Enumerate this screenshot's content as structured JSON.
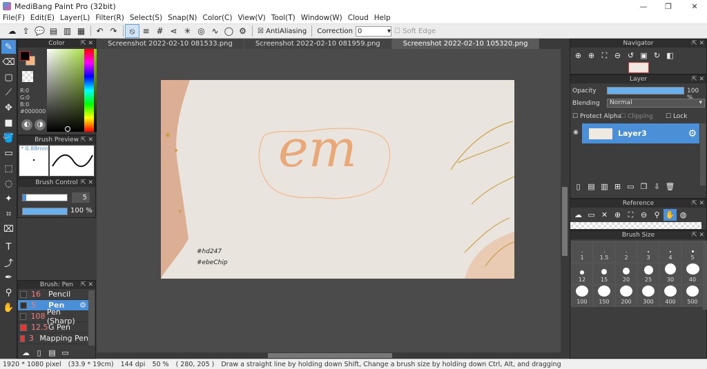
{
  "app": {
    "title": "MediBang Paint Pro (32bit)"
  },
  "menu": [
    "File(F)",
    "Edit(E)",
    "Layer(L)",
    "Filter(R)",
    "Select(S)",
    "Snap(N)",
    "Color(C)",
    "View(V)",
    "Tool(T)",
    "Window(W)",
    "Cloud",
    "Help"
  ],
  "toolbar": {
    "antialias_label": "AntiAliasing",
    "correction_label": "Correction",
    "correction_value": "0",
    "soft_edge_label": "Soft Edge"
  },
  "color_panel": {
    "title": "Color",
    "r": "R:0",
    "g": "G:0",
    "b": "B:0",
    "hex": "#000000",
    "primary_color": "#000000",
    "secondary_color": "#f0b880"
  },
  "brush_preview": {
    "title": "Brush Preview",
    "size": "* 0.88mm"
  },
  "brush_control": {
    "title": "Brush Control",
    "size_value": "5",
    "opacity_value": "100 %"
  },
  "brush_list": {
    "title": "Brush: Pen",
    "items": [
      {
        "size": "16",
        "name": "Pencil",
        "selected": false
      },
      {
        "size": "5",
        "name": "Pen",
        "selected": true
      },
      {
        "size": "108",
        "name": "Pen (Sharp)",
        "selected": false
      },
      {
        "size": "12.5",
        "name": "G Pen",
        "selected": false
      },
      {
        "size": "3",
        "name": "Mapping Pen",
        "selected": false
      }
    ]
  },
  "tabs": [
    {
      "label": "Screenshot 2022-02-10 081533.png",
      "active": false
    },
    {
      "label": "Screenshot 2022-02-10 081959.png",
      "active": false
    },
    {
      "label": "Screenshot 2022-02-10 105320.png",
      "active": true
    }
  ],
  "canvas": {
    "main_text": "em",
    "tag1": "#hd247",
    "tag2": "#ebeChip"
  },
  "navigator": {
    "title": "Navigator"
  },
  "layer_panel": {
    "title": "Layer",
    "opacity_label": "Opacity",
    "opacity_value": "100 %",
    "blending_label": "Blending",
    "blending_value": "Normal",
    "protect_alpha": "Protect Alpha",
    "clipping": "Clipping",
    "lock": "Lock",
    "layer_name": "Layer3"
  },
  "reference": {
    "title": "Reference"
  },
  "brush_size": {
    "title": "Brush Size",
    "sizes": [
      "1",
      "1.5",
      "2",
      "3",
      "4",
      "5",
      "12",
      "15",
      "20",
      "25",
      "30",
      "40",
      "100",
      "150",
      "200",
      "300",
      "400",
      "500"
    ]
  },
  "status": {
    "dimensions": "1920 * 1080 pixel",
    "physical": "(33.9 * 19cm)",
    "dpi": "144 dpi",
    "zoom": "50 %",
    "coords": "( 280, 205 )",
    "hint": "Draw a straight line by holding down Shift, Change a brush size by holding down Ctrl, Alt, and dragging"
  }
}
